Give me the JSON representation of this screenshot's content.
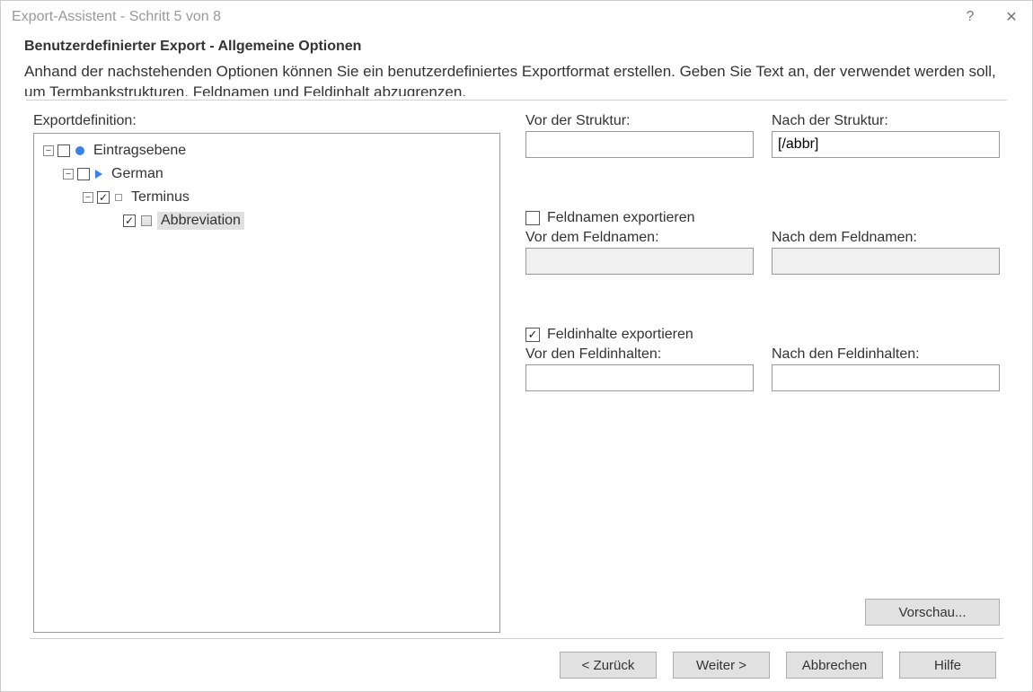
{
  "window": {
    "title": "Export-Assistent - Schritt 5 von 8",
    "help_icon": "?",
    "close_icon": "✕"
  },
  "section": {
    "title": "Benutzerdefinierter Export - Allgemeine Optionen",
    "description": "Anhand der nachstehenden Optionen können Sie ein benutzerdefiniertes Exportformat erstellen. Geben Sie Text an, der verwendet werden soll, um Termbankstrukturen, Feldnamen und Feldinhalt abzugrenzen."
  },
  "left": {
    "label": "Exportdefinition:",
    "tree": {
      "n0": {
        "label": "Eintragsebene",
        "checked": false
      },
      "n1": {
        "label": "German",
        "checked": false
      },
      "n2": {
        "label": "Terminus",
        "checked": true
      },
      "n3": {
        "label": "Abbreviation",
        "checked": true,
        "selected": true
      }
    }
  },
  "right": {
    "structure": {
      "before_label": "Vor der Struktur:",
      "before_value": "",
      "after_label": "Nach der Struktur:",
      "after_value": "[/abbr]"
    },
    "fieldnames": {
      "export_label": "Feldnamen exportieren",
      "export_checked": false,
      "before_label": "Vor dem Feldnamen:",
      "before_value": "",
      "after_label": "Nach dem Feldnamen:",
      "after_value": ""
    },
    "fieldvalues": {
      "export_label": "Feldinhalte exportieren",
      "export_checked": true,
      "before_label": "Vor den Feldinhalten:",
      "before_value": "",
      "after_label": "Nach den Feldinhalten:",
      "after_value": ""
    },
    "preview_label": "Vorschau..."
  },
  "footer": {
    "back": "< Zurück",
    "next": "Weiter >",
    "cancel": "Abbrechen",
    "help": "Hilfe"
  }
}
